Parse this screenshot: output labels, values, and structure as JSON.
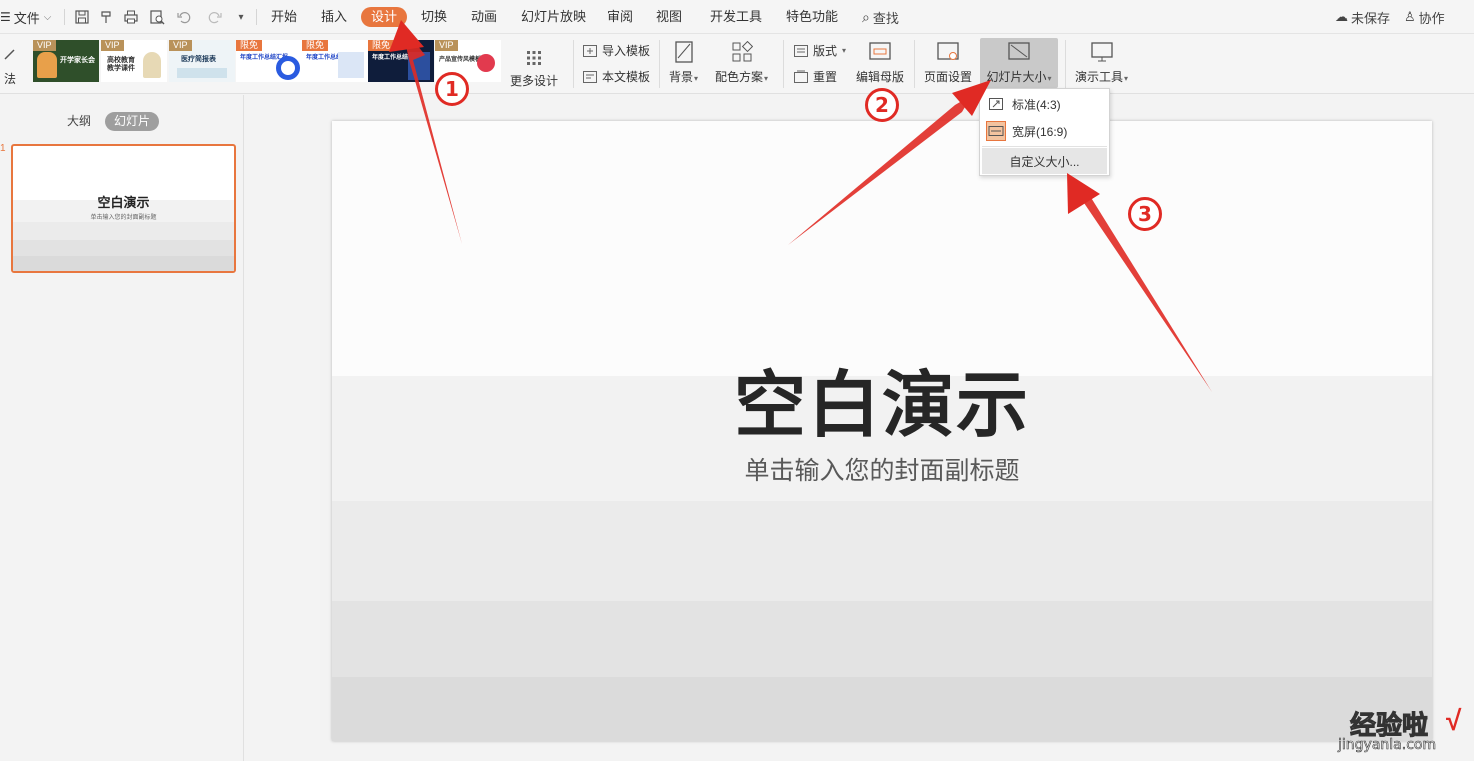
{
  "menubar": {
    "file_label": "文件",
    "tabs": [
      "开始",
      "插入",
      "设计",
      "切换",
      "动画",
      "幻灯片放映",
      "审阅",
      "视图",
      "开发工具",
      "特色功能"
    ],
    "active_tab": "设计",
    "search_label": "查找",
    "unsaved_label": "未保存",
    "collab_label": "协作"
  },
  "ribbon": {
    "left_cut_label": "法",
    "templates": [
      {
        "badge": "VIP",
        "title": "开学家长会"
      },
      {
        "badge": "VIP",
        "title": "高校教育教学课件"
      },
      {
        "badge": "VIP",
        "title": "医疗简报表"
      },
      {
        "badge": "限免",
        "title": "年度工作总结汇报"
      },
      {
        "badge": "限免",
        "title": "年度工作总结汇报"
      },
      {
        "badge": "限免",
        "title": "年度工作总结汇报"
      },
      {
        "badge": "VIP",
        "title": "产品宣传风模板"
      }
    ],
    "more_design": "更多设计",
    "import_template": "导入模板",
    "this_template": "本文模板",
    "background": "背景",
    "color_scheme": "配色方案",
    "layout": "版式",
    "reset": "重置",
    "edit_master": "编辑母版",
    "page_setup": "页面设置",
    "slide_size": "幻灯片大小",
    "presenter_tools": "演示工具"
  },
  "dropdown": {
    "standard": "标准(4:3)",
    "widescreen": "宽屏(16:9)",
    "custom": "自定义大小..."
  },
  "leftpanel": {
    "tab_outline": "大纲",
    "tab_slides": "幻灯片",
    "slide_number": "1",
    "thumb_title": "空白演示",
    "thumb_subtitle": "单击输入您的封面副标题"
  },
  "slide": {
    "title": "空白演示",
    "subtitle": "单击输入您的封面副标题"
  },
  "annotations": {
    "step1": "1",
    "step2": "2",
    "step3": "3"
  },
  "watermark": {
    "brand": "经验啦",
    "url": "jingyanla.com",
    "check": "√"
  },
  "colors": {
    "accent": "#e8763e",
    "arrow": "#e02a24"
  }
}
